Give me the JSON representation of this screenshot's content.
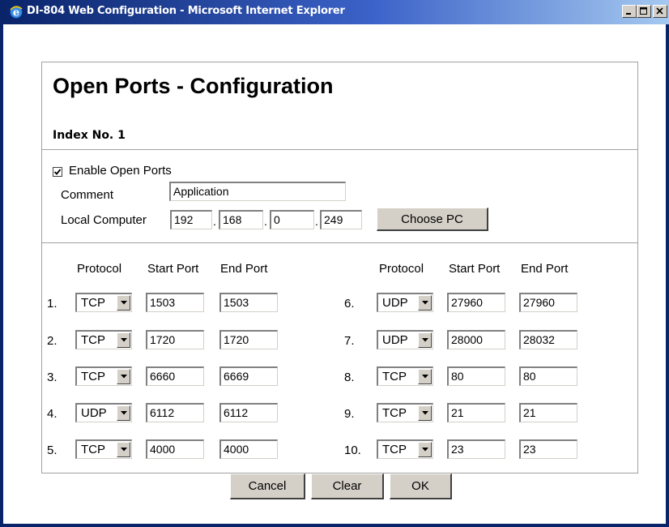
{
  "window": {
    "title": "DI-804 Web Configuration - Microsoft Internet Explorer",
    "icon": "ie-icon"
  },
  "page": {
    "heading": "Open Ports - Configuration",
    "index_label": "Index No. 1",
    "enable_label": "Enable Open Ports",
    "enable_checked": true,
    "comment_label": "Comment",
    "comment_value": "Application",
    "local_label": "Local Computer",
    "ip": [
      "192",
      "168",
      "0",
      "249"
    ],
    "choose_pc": "Choose PC"
  },
  "headers": {
    "protocol": "Protocol",
    "start": "Start Port",
    "end": "End Port"
  },
  "rows": [
    {
      "num": "1.",
      "protocol": "TCP",
      "start": "1503",
      "end": "1503"
    },
    {
      "num": "2.",
      "protocol": "TCP",
      "start": "1720",
      "end": "1720"
    },
    {
      "num": "3.",
      "protocol": "TCP",
      "start": "6660",
      "end": "6669"
    },
    {
      "num": "4.",
      "protocol": "UDP",
      "start": "6112",
      "end": "6112"
    },
    {
      "num": "5.",
      "protocol": "TCP",
      "start": "4000",
      "end": "4000"
    },
    {
      "num": "6.",
      "protocol": "UDP",
      "start": "27960",
      "end": "27960"
    },
    {
      "num": "7.",
      "protocol": "UDP",
      "start": "28000",
      "end": "28032"
    },
    {
      "num": "8.",
      "protocol": "TCP",
      "start": "80",
      "end": "80"
    },
    {
      "num": "9.",
      "protocol": "TCP",
      "start": "21",
      "end": "21"
    },
    {
      "num": "10.",
      "protocol": "TCP",
      "start": "23",
      "end": "23"
    }
  ],
  "buttons": {
    "cancel": "Cancel",
    "clear": "Clear",
    "ok": "OK"
  }
}
